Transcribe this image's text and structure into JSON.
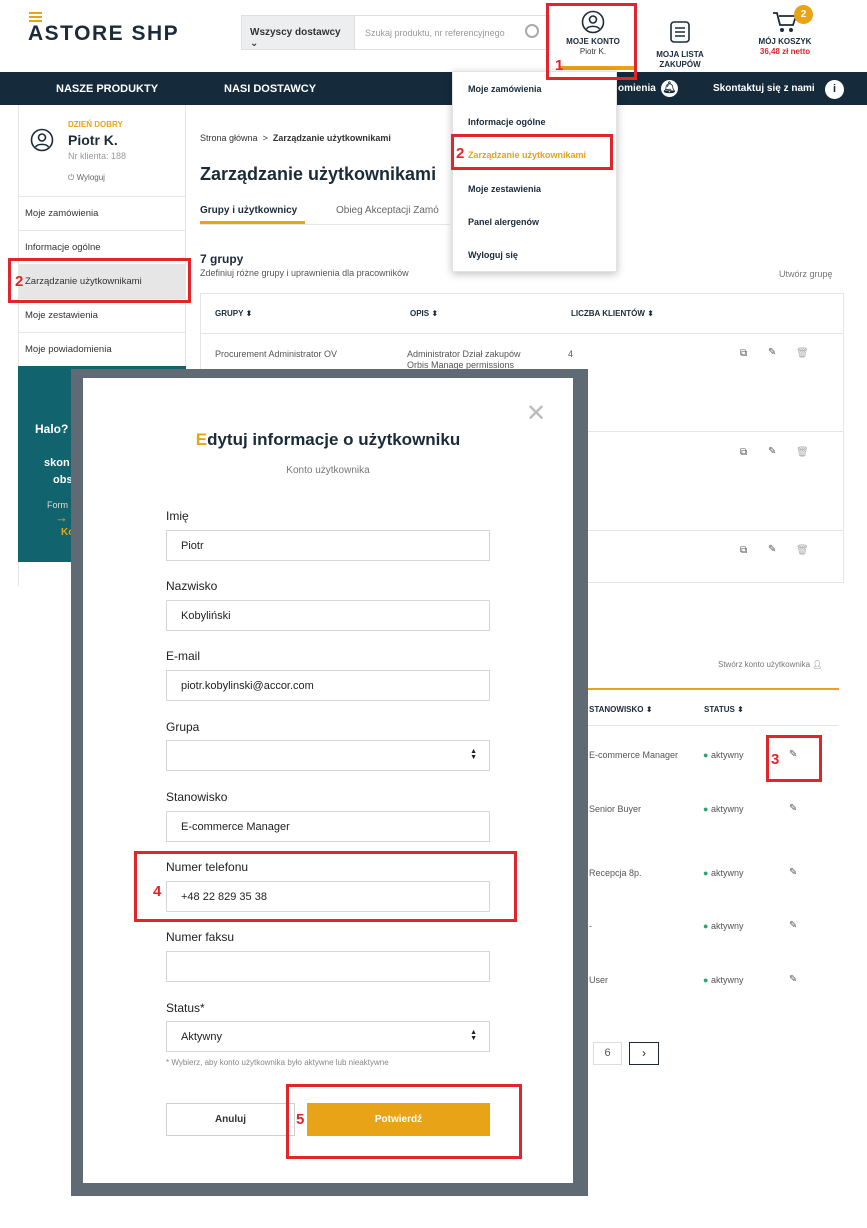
{
  "header": {
    "logo_a": "ASTORE SH",
    "logo_b": "P",
    "supplier_select": "Wszyscy dostawcy",
    "search_placeholder": "Szukaj produktu, nr referencyjnego",
    "account_label": "MOJE KONTO",
    "account_user": "Piotr K.",
    "shopping_list": "MOJA LISTA\nZAKUPÓW",
    "cart_label": "MÓJ KOSZYK",
    "cart_amount": "36,48 zł netto",
    "cart_count": "2"
  },
  "nav": {
    "products": "NASZE PRODUKTY",
    "suppliers": "NASI DOSTAWCY",
    "notifications": "omienia",
    "contact": "Skontaktuj się z nami"
  },
  "sidebar": {
    "greeting": "DZIEŃ DOBRY",
    "name": "Piotr K.",
    "client_no": "Nr klienta: 188",
    "logout": "Wyloguj",
    "items": [
      "Moje zamówienia",
      "Informacje ogólne",
      "Zarządzanie użytkownikami",
      "Moje zestawienia",
      "Moje powiadomienia"
    ],
    "promo": {
      "t1": "Halo?",
      "t2": "skon",
      "t3": "obs",
      "t4": "Form",
      "t5": "Ko"
    }
  },
  "breadcrumb": {
    "home": "Strona główna",
    "sep": ">",
    "current": "Zarządzanie użytkownikami"
  },
  "page": {
    "title": "Zarządzanie użytkownikami",
    "tabs": [
      "Grupy i użytkownicy",
      "Obieg Akceptacji Zamó"
    ],
    "groups_count": "7 grupy",
    "groups_desc": "Zdefiniuj różne grupy i uprawnienia dla pracowników",
    "create_group": "Utwórz grupę",
    "create_user": "Stwórz konto użytkownika"
  },
  "groups_table": {
    "headers": [
      "GRUPY",
      "OPIS",
      "LICZBA KLIENTÓW"
    ],
    "row1": {
      "group": "Procurement Administrator OV",
      "desc1": "Administrator Dział zakupów",
      "desc2": "Orbis Manage permissions",
      "count": "4"
    }
  },
  "users_table": {
    "headers": [
      "STANOWISKO",
      "STATUS"
    ],
    "rows": [
      {
        "position": "E-commerce Manager",
        "status": "aktywny"
      },
      {
        "position": "Senior Buyer",
        "status": "aktywny"
      },
      {
        "position": "Recepcja 8p.",
        "status": "aktywny"
      },
      {
        "position": "-",
        "status": "aktywny"
      },
      {
        "position": "User",
        "status": "aktywny"
      }
    ],
    "page": "6"
  },
  "dropdown": {
    "items": [
      "Moje zamówienia",
      "Informacje ogólne",
      "Zarządzanie użytkownikami",
      "Moje zestawienia",
      "Panel alergenów",
      "Wyloguj się"
    ]
  },
  "modal": {
    "title_first": "E",
    "title_rest": "dytuj informacje o użytkowniku",
    "subtitle": "Konto użytkownika",
    "fields": {
      "first_name_label": "Imię",
      "first_name": "Piotr",
      "last_name_label": "Nazwisko",
      "last_name": "Kobyliński",
      "email_label": "E-mail",
      "email": "piotr.kobylinski@accor.com",
      "group_label": "Grupa",
      "group": "",
      "position_label": "Stanowisko",
      "position": "E-commerce Manager",
      "phone_label": "Numer telefonu",
      "phone": "+48 22 829 35 38",
      "fax_label": "Numer faksu",
      "fax": "",
      "status_label": "Status*",
      "status": "Aktywny",
      "status_hint": "* Wybierz, aby konto użytkownika było aktywne lub nieaktywne"
    },
    "cancel": "Anuluj",
    "confirm": "Potwierdź"
  },
  "annotations": [
    "1",
    "2",
    "2",
    "3",
    "4",
    "5"
  ],
  "colors": {
    "accent": "#e8a317",
    "navy": "#152b3c",
    "highlight": "#e0252b",
    "teal": "#11636e"
  }
}
